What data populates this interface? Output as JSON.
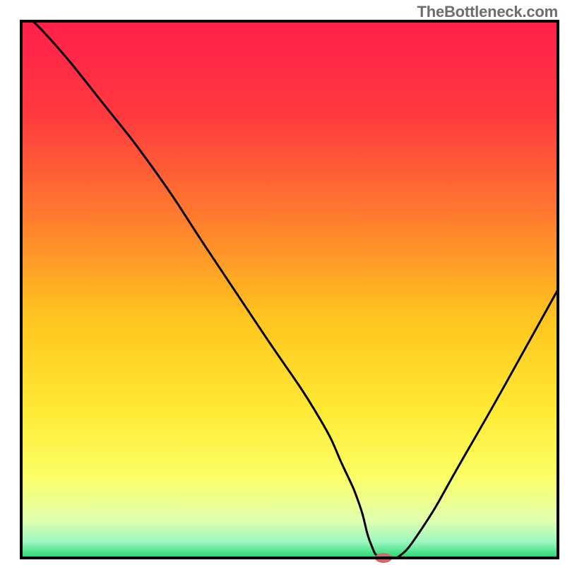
{
  "watermark": "TheBottleneck.com",
  "chart_data": {
    "type": "line",
    "title": "",
    "xlabel": "",
    "ylabel": "",
    "xlim": [
      0,
      100
    ],
    "ylim": [
      0,
      100
    ],
    "background_gradient_stops": [
      {
        "offset": 0.0,
        "color": "#ff1f4a"
      },
      {
        "offset": 0.18,
        "color": "#ff3b3e"
      },
      {
        "offset": 0.36,
        "color": "#ff7a2e"
      },
      {
        "offset": 0.55,
        "color": "#ffc41f"
      },
      {
        "offset": 0.72,
        "color": "#ffe933"
      },
      {
        "offset": 0.85,
        "color": "#fbff66"
      },
      {
        "offset": 0.93,
        "color": "#e0ffb0"
      },
      {
        "offset": 0.97,
        "color": "#9cf7c1"
      },
      {
        "offset": 1.0,
        "color": "#1fd96f"
      }
    ],
    "series": [
      {
        "name": "bottleneck-curve",
        "color": "#000000",
        "x": [
          0,
          6,
          15,
          25,
          35,
          45,
          55,
          60,
          63,
          65,
          67,
          70,
          75,
          82,
          90,
          100
        ],
        "values": [
          102,
          96,
          85,
          72,
          57,
          42,
          27,
          17,
          10,
          3,
          0,
          0,
          6,
          18,
          32,
          50
        ]
      }
    ],
    "marker": {
      "name": "optimal-point",
      "x": 67.5,
      "y": 0,
      "rx": 12,
      "ry": 7,
      "color": "#d06a6a"
    },
    "frame_color": "#000000",
    "frame_width": 4
  }
}
